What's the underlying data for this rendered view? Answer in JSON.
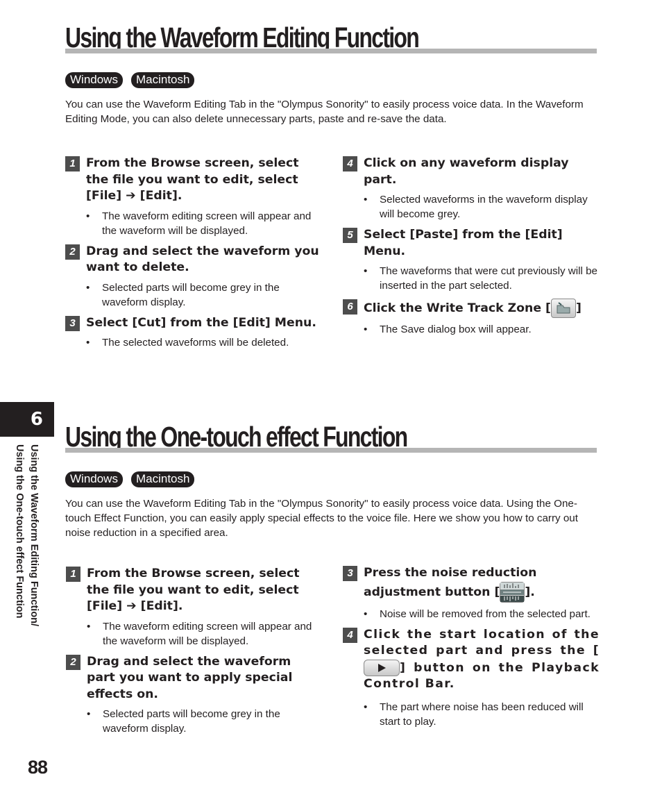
{
  "chapter_tab": "6",
  "side_label": {
    "line1": "Using the Waveform Editing Function/",
    "line2": "Using the One-touch effect Function"
  },
  "page_number": "88",
  "sections": [
    {
      "title": "Using the Waveform Editing Function",
      "badges": [
        "Windows",
        "Macintosh"
      ],
      "intro": "You can use the Waveform Editing Tab in the \"Olympus Sonority\" to easily process voice data. In the Waveform Editing Mode, you can also delete unnecessary parts, paste and re-save the data.",
      "steps": [
        {
          "num": "1",
          "text": "From the Browse screen, select the file you want to edit, select [File] ➔ [Edit].",
          "bullet": "The waveform editing screen will appear and the waveform will be displayed."
        },
        {
          "num": "2",
          "text": "Drag and select the waveform you want to delete.",
          "bullet": "Selected parts will become grey in the waveform display."
        },
        {
          "num": "3",
          "text": "Select [Cut] from the [Edit] Menu.",
          "bullet": "The selected waveforms will be deleted."
        },
        {
          "num": "4",
          "text": "Click on any waveform display part.",
          "bullet": "Selected waveforms in the waveform display will become grey."
        },
        {
          "num": "5",
          "text": "Select [Paste] from the [Edit] Menu.",
          "bullet": "The waveforms that were cut previously will be inserted in the part selected."
        },
        {
          "num": "6",
          "text_before": "Click the Write Track Zone [",
          "text_after": "]",
          "icon": "write-track-zone-icon",
          "bullet": "The Save dialog box will appear."
        }
      ]
    },
    {
      "title": "Using the One-touch effect Function",
      "badges": [
        "Windows",
        "Macintosh"
      ],
      "intro": "You can use the Waveform Editing Tab in the \"Olympus Sonority\" to easily process voice data. Using the One-touch Effect Function, you can easily apply special effects to the voice file. Here we show you how to carry out noise reduction in a specified area.",
      "steps": [
        {
          "num": "1",
          "text": "From the Browse screen, select the file you want to edit, select [File] ➔ [Edit].",
          "bullet": "The waveform editing screen will appear and the waveform will be displayed."
        },
        {
          "num": "2",
          "text": "Drag and select the waveform part you want to apply special effects on.",
          "bullet": "Selected parts will become grey in the waveform display."
        },
        {
          "num": "3",
          "text_before": "Press the noise reduction adjustment button [",
          "text_after": "].",
          "icon": "noise-reduction-icon",
          "bullet": "Noise will be removed from the selected part."
        },
        {
          "num": "4",
          "text_before": "Click the start location of the selected part and press the [",
          "text_after": "] button on the Playback Control Bar.",
          "icon": "play-icon",
          "bullet": "The part where noise has been reduced will start to play."
        }
      ]
    }
  ]
}
